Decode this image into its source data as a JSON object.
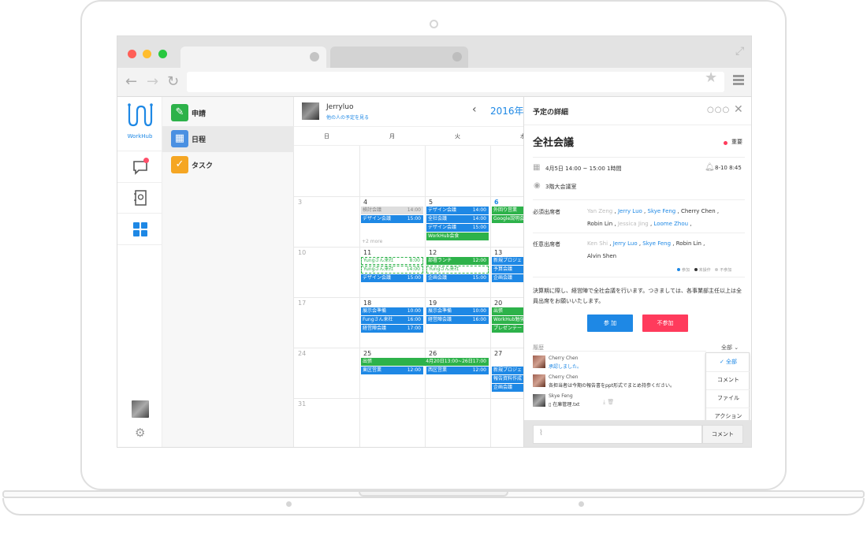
{
  "logo_text": "WorkHub",
  "menu": [
    {
      "label": "申請",
      "color": "#2db24a",
      "icon": "pen-icon"
    },
    {
      "label": "日程",
      "color": "#4a90e2",
      "icon": "calendar-icon"
    },
    {
      "label": "タスク",
      "color": "#f5a623",
      "icon": "check-circle-icon"
    }
  ],
  "calendar": {
    "user_name": "Jerryluo",
    "user_link": "他の人の予定を見る",
    "year_label": "2016年",
    "weekdays": [
      "日",
      "月",
      "火",
      "水"
    ],
    "weeks": [
      {
        "days": [
          "3",
          "4",
          "5",
          "6"
        ]
      },
      {
        "days": [
          "10",
          "11",
          "12",
          "13"
        ]
      },
      {
        "days": [
          "17",
          "18",
          "19",
          "20"
        ]
      },
      {
        "days": [
          "24",
          "25",
          "26",
          "27"
        ]
      },
      {
        "days": [
          "31",
          "",
          "",
          ""
        ]
      }
    ],
    "events": {
      "w1_mon": [
        {
          "title": "検討会議",
          "time": "14:00",
          "style": "grey"
        },
        {
          "title": "デザイン会議",
          "time": "15:00",
          "style": "blue"
        }
      ],
      "w1_tue": [
        {
          "title": "デザイン会議",
          "time": "14:00",
          "style": "blue"
        },
        {
          "title": "全社会議",
          "time": "14:00",
          "style": "blue"
        },
        {
          "title": "デザイン会議",
          "time": "15:00",
          "style": "blue"
        },
        {
          "title": "WorkHub会食",
          "time": "",
          "style": "green"
        }
      ],
      "w1_wed": [
        {
          "title": "外回り営業",
          "style": "green"
        },
        {
          "title": "Google説明会",
          "style": "green"
        }
      ],
      "w2_mon": [
        {
          "title": "Yungさん来社",
          "time": "8:00",
          "style": "dashed"
        },
        {
          "title": "Yungさん来社",
          "time": "14:00",
          "style": "dashed"
        },
        {
          "title": "デザイン会議",
          "time": "15:00",
          "style": "blue"
        }
      ],
      "w2_more": "+2 more",
      "w2_tue": [
        {
          "title": "部署ランチ",
          "time": "12:00",
          "style": "green"
        },
        {
          "title": "Yungさん来社",
          "time": "",
          "style": "dashed"
        },
        {
          "title": "企画会議",
          "time": "15:00",
          "style": "blue"
        }
      ],
      "w2_wed": [
        {
          "title": "新規プロジェ",
          "style": "blue"
        },
        {
          "title": "予算会議",
          "style": "blue"
        },
        {
          "title": "企画会議",
          "style": "blue"
        }
      ],
      "w3_mon": [
        {
          "title": "展示会準備",
          "time": "10:00",
          "style": "blue"
        },
        {
          "title": "Fungさん来社",
          "time": "16:00",
          "style": "blue"
        },
        {
          "title": "経営陣会議",
          "time": "17:00",
          "style": "blue"
        }
      ],
      "w3_tue": [
        {
          "title": "展示会準備",
          "time": "10:00",
          "style": "blue"
        },
        {
          "title": "経営陣会議",
          "time": "16:00",
          "style": "blue"
        }
      ],
      "w3_wed": [
        {
          "title": "出張",
          "style": "green"
        },
        {
          "title": "WorkHub勉強",
          "style": "green"
        },
        {
          "title": "プレゼンテー",
          "style": "green"
        }
      ],
      "w4_span": {
        "title": "出張",
        "time": "4月20日13:00~26日17:00",
        "style": "green"
      },
      "w4_mon": [
        {
          "title": "東区営業",
          "time": "12:00",
          "style": "blue"
        }
      ],
      "w4_tue": [
        {
          "title": "西区営業",
          "time": "12:00",
          "style": "blue"
        }
      ],
      "w4_wed": [
        {
          "title": "新規プロジェ",
          "style": "blue"
        },
        {
          "title": "報告資料作成",
          "style": "blue"
        },
        {
          "title": "企画会議",
          "style": "blue"
        }
      ]
    }
  },
  "panel": {
    "title": "予定の詳細",
    "event_title": "全社会議",
    "importance": "重要",
    "datetime": "4月5日 14:00 ~ 15:00 1時間",
    "reminder": "8-10 8:45",
    "location": "3階大会議室",
    "required_label": "必須出席者",
    "required_line1": [
      {
        "name": "Yan Zeng",
        "style": "n-grey"
      },
      {
        "name": "Jerry Luo",
        "style": "n-blue"
      },
      {
        "name": "Skye Feng",
        "style": "n-blue"
      },
      {
        "name": "Cherry Chen",
        "style": ""
      }
    ],
    "required_line2": [
      {
        "name": "Robin Lin",
        "style": ""
      },
      {
        "name": "Jessica Jing",
        "style": "n-grey"
      },
      {
        "name": "Loome Zhou",
        "style": "n-blue"
      }
    ],
    "optional_label": "任意出席者",
    "optional_line1": [
      {
        "name": "Ken Shi",
        "style": "n-grey"
      },
      {
        "name": "Jerry Luo",
        "style": "n-blue"
      },
      {
        "name": "Skye Feng",
        "style": "n-blue"
      },
      {
        "name": "Robin Lin",
        "style": ""
      }
    ],
    "optional_line2": [
      {
        "name": "Alvin Shen",
        "style": ""
      }
    ],
    "legend": {
      "attend": "参加",
      "undecided": "未操作",
      "absent": "不参加"
    },
    "description": "決算期に際し、経営陣で全社会議を行います。つきましては、各事業部主任以上は全員出席をお願いいたします。",
    "join_button": "参 加",
    "decline_button": "不参加",
    "history_label": "履歴",
    "history_filter": "全部",
    "history": [
      {
        "name": "Cherry Chen",
        "text": "承認しました。",
        "blue": true
      },
      {
        "name": "Cherry Chen",
        "text": "各担当者は今期の報告書をppt形式でまとめ持参ください。",
        "blue": false
      },
      {
        "name": "Skye Feng",
        "text": "在庫管理.txt",
        "blue": false
      }
    ],
    "dropdown": [
      "全部",
      "コメント",
      "ファイル",
      "アクション"
    ],
    "comment_button": "コメント",
    "accent_color": "#1e88e5",
    "decline_color": "#ff3b5c"
  }
}
